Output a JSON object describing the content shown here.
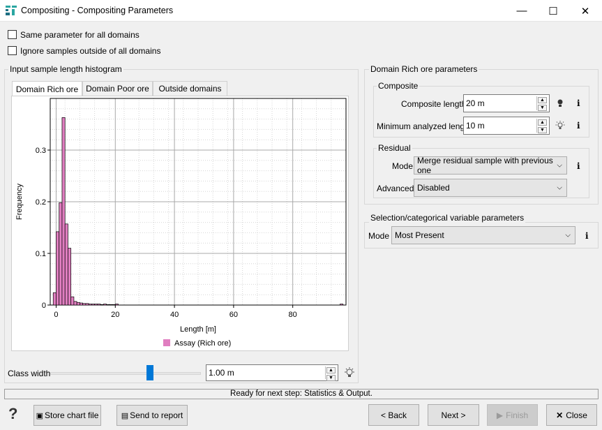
{
  "window": {
    "title": "Compositing - Compositing Parameters",
    "minimize": "—",
    "maximize": "☐",
    "close": "✕"
  },
  "options": {
    "same_param": "Same parameter for all domains",
    "ignore_samples": "Ignore samples outside of all domains"
  },
  "histogram": {
    "group_title": "Input sample length histogram",
    "tabs": [
      "Domain Rich ore",
      "Domain Poor ore",
      "Outside domains"
    ],
    "class_width_label": "Class width",
    "class_width_value": "1.00 m",
    "class_width_fraction": 0.66
  },
  "chart_data": {
    "type": "bar",
    "xlabel": "Length [m]",
    "ylabel": "Frequency",
    "xlim": [
      -2,
      98
    ],
    "ylim": [
      0,
      0.4
    ],
    "xticks": [
      0,
      20,
      40,
      60,
      80
    ],
    "yticks": [
      0,
      0.1,
      0.2,
      0.3
    ],
    "ytick_labels": [
      "0",
      "0.1",
      "0.2",
      "0.3"
    ],
    "bin_width": 1,
    "series": [
      {
        "name": "Assay (Rich ore)",
        "color": "#e07ec0",
        "bins": [
          [
            -1,
            0.024
          ],
          [
            0,
            0.142
          ],
          [
            1,
            0.198
          ],
          [
            2,
            0.363
          ],
          [
            3,
            0.157
          ],
          [
            4,
            0.11
          ],
          [
            5,
            0.016
          ],
          [
            6,
            0.007
          ],
          [
            7,
            0.005
          ],
          [
            8,
            0.004
          ],
          [
            9,
            0.003
          ],
          [
            10,
            0.003
          ],
          [
            11,
            0.002
          ],
          [
            12,
            0.002
          ],
          [
            13,
            0.002
          ],
          [
            14,
            0.002
          ],
          [
            15,
            0.001
          ],
          [
            16,
            0.002
          ],
          [
            17,
            0.001
          ],
          [
            18,
            0.001
          ],
          [
            19,
            0.001
          ],
          [
            20,
            0.002
          ],
          [
            96,
            0.002
          ]
        ]
      }
    ]
  },
  "rich_ore": {
    "group_title": "Domain Rich ore parameters",
    "composite_title": "Composite",
    "composite_length_label": "Composite length",
    "composite_length_value": "20 m",
    "min_length_label": "Minimum analyzed length",
    "min_length_value": "10 m",
    "residual_title": "Residual",
    "mode_label": "Mode",
    "mode_value": "Merge residual sample with previous one",
    "advanced_label": "Advanced",
    "advanced_value": "Disabled",
    "info": "i"
  },
  "selection": {
    "group_title": "Selection/categorical variable parameters",
    "mode_label": "Mode",
    "mode_value": "Most Present",
    "info": "i"
  },
  "status": "Ready for next step: Statistics & Output.",
  "buttons": {
    "help": "?",
    "store_chart": "Store chart file",
    "send_report": "Send to report",
    "back": "< Back",
    "next": "Next >",
    "finish": "Finish",
    "close": "Close"
  }
}
